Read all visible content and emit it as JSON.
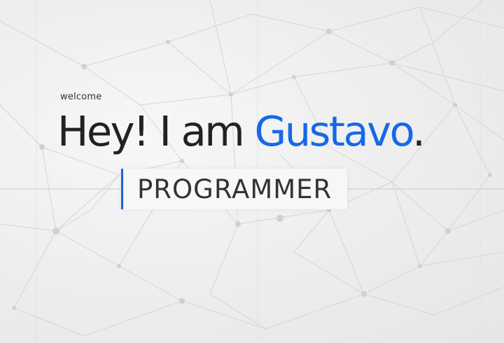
{
  "hero": {
    "welcome": "welcome",
    "greeting": "Hey! I am ",
    "name": "Gustavo",
    "punctuation": ".",
    "role": "PROGRAMMER"
  },
  "colors": {
    "accent": "#1668e8",
    "text": "#222222",
    "background": "#efefef"
  }
}
